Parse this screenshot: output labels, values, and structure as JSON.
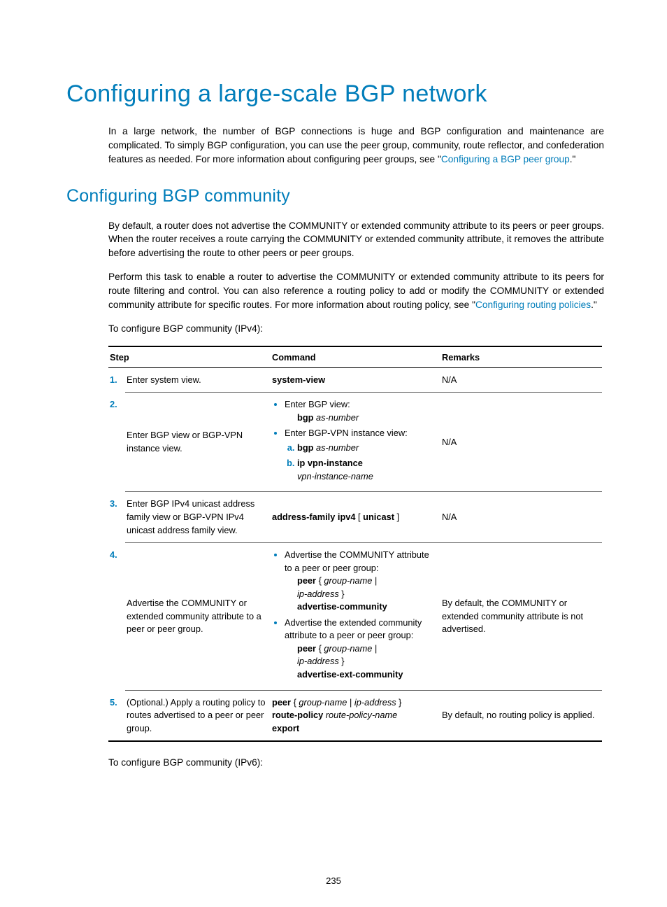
{
  "h1": "Configuring a large-scale BGP network",
  "intro_a": "In a large network, the number of BGP connections is huge and BGP configuration and maintenance are complicated. To simply BGP configuration, you can use the peer group, community, route reflector, and confederation features as needed. For more information about configuring peer groups, see \"",
  "intro_link": "Configuring a BGP peer group",
  "intro_b": ".\"",
  "h2": "Configuring BGP community",
  "p2": "By default, a router does not advertise the COMMUNITY or extended community attribute to its peers or peer groups. When the router receives a route carrying the COMMUNITY or extended community attribute, it removes the attribute before advertising the route to other peers or peer groups.",
  "p3_a": "Perform this task to enable a router to advertise the COMMUNITY or extended community attribute to its peers for route filtering and control. You can also reference a routing policy to add or modify the COMMUNITY or extended community attribute for specific routes. For more information about routing policy, see \"",
  "p3_link": "Configuring routing policies",
  "p3_b": ".\"",
  "p4": "To configure BGP community (IPv4):",
  "headers": {
    "c1": "Step",
    "c2": "Command",
    "c3": "Remarks"
  },
  "rows": {
    "r1": {
      "n": "1.",
      "step": "Enter system view.",
      "cmd": "system-view",
      "rmk": "N/A"
    },
    "r2": {
      "n": "2.",
      "step": "Enter BGP view or BGP-VPN instance view.",
      "b1_text": "Enter BGP view:",
      "b1_cmd_b": "bgp",
      "b1_cmd_i": "as-number",
      "b2_text": "Enter BGP-VPN instance view:",
      "b2_a_b": "bgp",
      "b2_a_i": "as-number",
      "b2_b_b": "ip vpn-instance",
      "b2_b_i": "vpn-instance-name",
      "rmk": "N/A"
    },
    "r3": {
      "n": "3.",
      "step": "Enter BGP IPv4 unicast address family view or BGP-VPN IPv4 unicast address family view.",
      "cmd_b": "address-family ipv4",
      "cmd_plain": " [ ",
      "cmd_b2": "unicast",
      "cmd_plain2": " ]",
      "rmk": "N/A"
    },
    "r4": {
      "n": "4.",
      "step": "Advertise the COMMUNITY or extended community attribute to a peer or peer group.",
      "b1_text": "Advertise the COMMUNITY attribute to a peer or peer group:",
      "b1_l1_b": "peer",
      "b1_l1_plain": " { ",
      "b1_l1_i1": "group-name",
      "b1_l1_plain2": " | ",
      "b1_l1_i2": "ip-address",
      "b1_l1_plain3": " } ",
      "b1_l1_b2": "advertise-community",
      "b2_text": "Advertise the extended community attribute to a peer or peer group:",
      "b2_l1_b": "peer",
      "b2_l1_plain": " { ",
      "b2_l1_i1": "group-name",
      "b2_l1_plain2": " | ",
      "b2_l1_i2": "ip-address",
      "b2_l1_plain3": " } ",
      "b2_l1_b2": "advertise-ext-community",
      "rmk": "By default, the COMMUNITY or extended community attribute is not advertised."
    },
    "r5": {
      "n": "5.",
      "step": "(Optional.) Apply a routing policy to routes advertised to a peer or peer group.",
      "c_b1": "peer",
      "c_p1": " { ",
      "c_i1": "group-name",
      "c_p2": " | ",
      "c_i2": "ip-address",
      "c_p3": " } ",
      "c_b2": "route-policy",
      "c_sp": " ",
      "c_i3": "route-policy-name",
      "c_b3": "export",
      "rmk": "By default, no routing policy is applied."
    }
  },
  "p5": "To configure BGP community (IPv6):",
  "pagenum": "235"
}
